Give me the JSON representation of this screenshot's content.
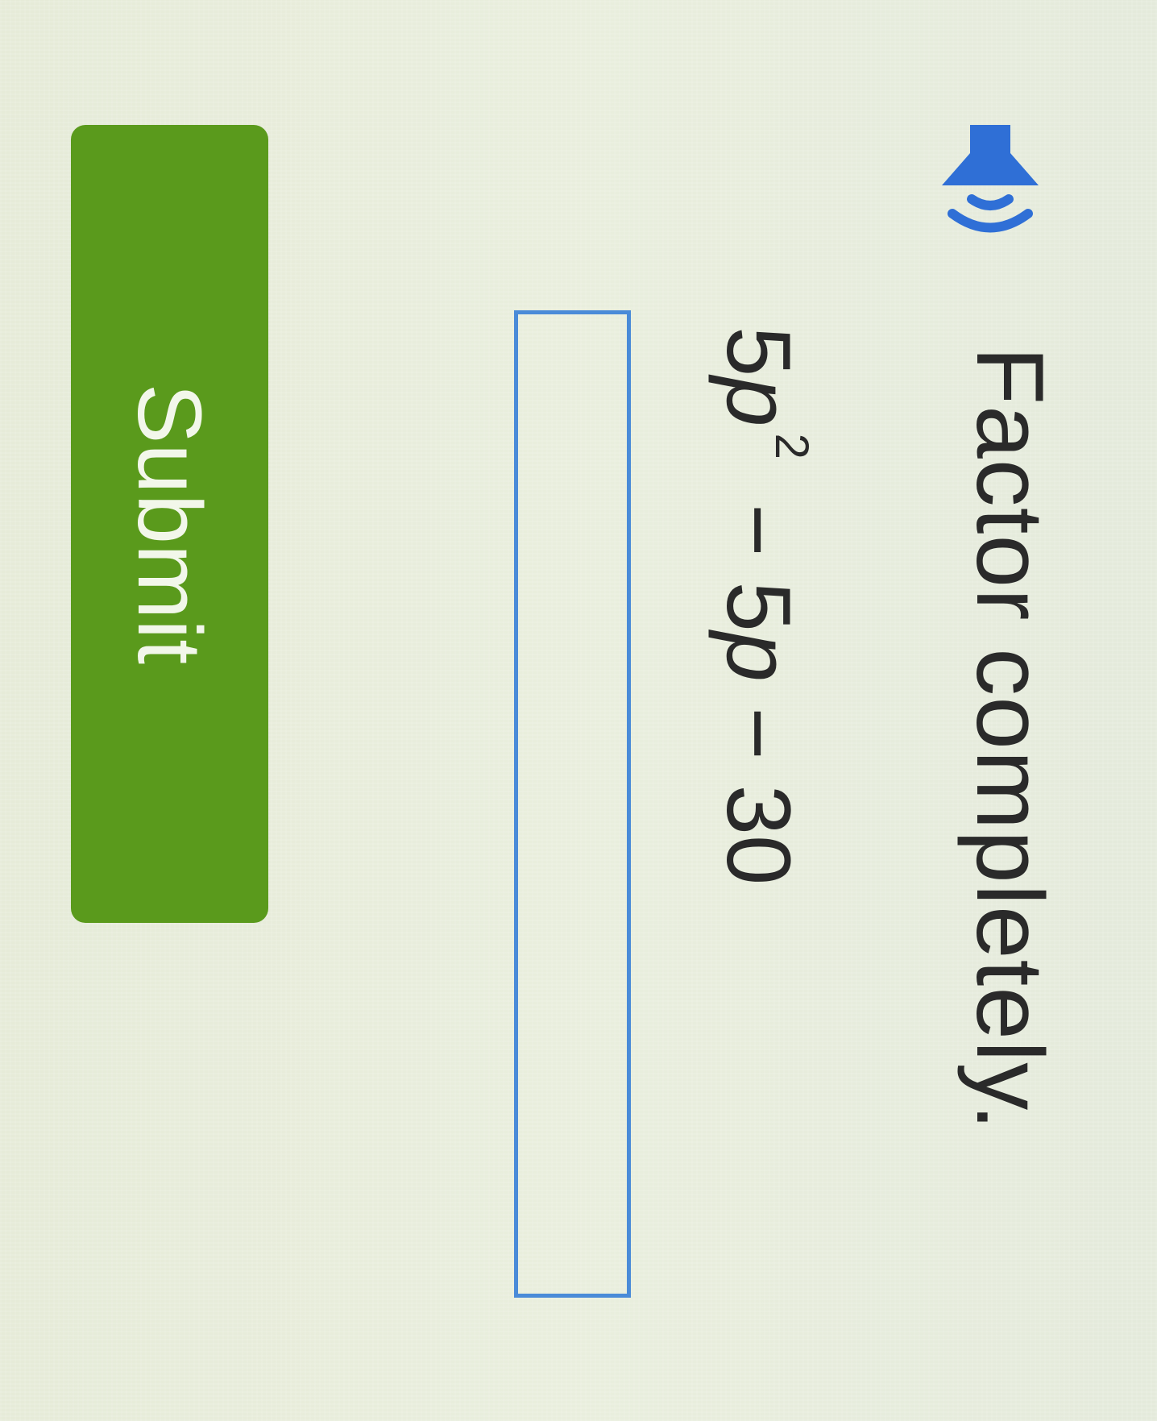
{
  "question": {
    "prompt": "Factor completely.",
    "expression": {
      "coefficient_1": "5",
      "variable_1": "p",
      "exponent": "2",
      "operator_1": " − ",
      "coefficient_2": "5",
      "variable_2": "p",
      "operator_2": " − ",
      "constant": "30"
    },
    "speaker_icon": "speaker-icon"
  },
  "answer": {
    "value": "",
    "placeholder": ""
  },
  "submit": {
    "label": "Submit"
  },
  "colors": {
    "background": "#e8eddb",
    "text": "#2a2a2a",
    "speaker": "#2f6fd6",
    "input_border": "#4a8bd8",
    "button_bg": "#5a9a1c",
    "button_text": "#f2f7ea"
  }
}
